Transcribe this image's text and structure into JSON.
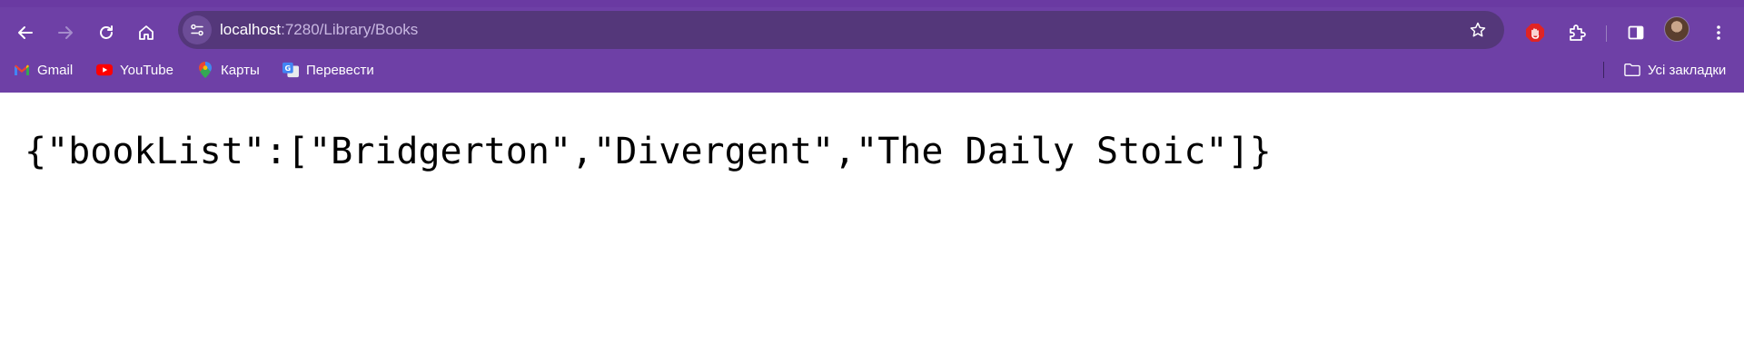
{
  "toolbar": {
    "back_icon": "arrow-left-icon",
    "forward_icon": "arrow-right-icon",
    "reload_icon": "reload-icon",
    "home_icon": "home-icon",
    "address": {
      "host": "localhost",
      "path": ":7280/Library/Books"
    },
    "bookmark_star_icon": "star-icon",
    "extensions": [
      "adblock-hand-icon",
      "puzzle-extensions-icon"
    ],
    "side_panel_icon": "side-panel-icon",
    "menu_icon": "more-vertical-icon"
  },
  "bookmarks": {
    "items": [
      {
        "label": "Gmail",
        "icon": "gmail-icon"
      },
      {
        "label": "YouTube",
        "icon": "youtube-icon"
      },
      {
        "label": "Карты",
        "icon": "maps-icon"
      },
      {
        "label": "Перевести",
        "icon": "translate-icon"
      }
    ],
    "all_bookmarks": {
      "label": "Усі закладки",
      "icon": "folder-icon"
    }
  },
  "content": {
    "json_text": "{\"bookList\":[\"Bridgerton\",\"Divergent\",\"The Daily Stoic\"]}"
  },
  "colors": {
    "frame": "#6e40a6",
    "omnibox": "#54377a",
    "page_background": "#ffffff"
  }
}
